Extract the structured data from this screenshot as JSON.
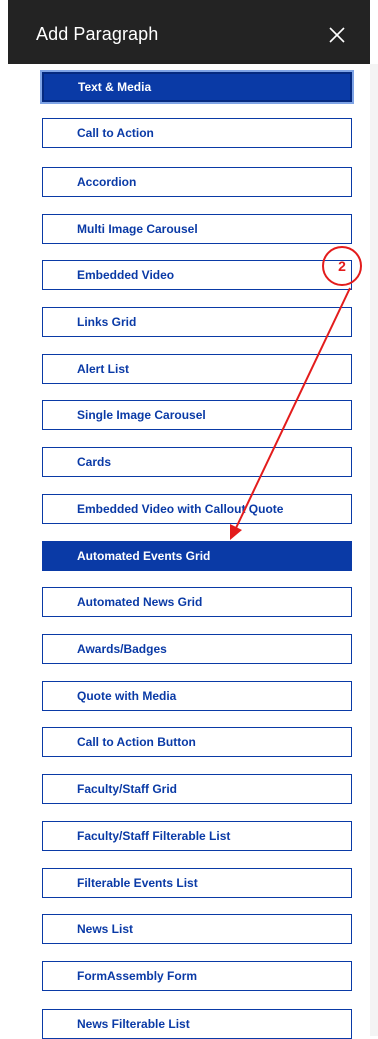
{
  "dialog": {
    "title": "Add Paragraph",
    "close_icon": "close-icon"
  },
  "paragraph_types": [
    {
      "label": "Text & Media",
      "state": "selected"
    },
    {
      "label": "Call to Action",
      "state": "normal"
    },
    {
      "label": "Accordion",
      "state": "normal"
    },
    {
      "label": "Multi Image Carousel",
      "state": "normal"
    },
    {
      "label": "Embedded Video",
      "state": "normal"
    },
    {
      "label": "Links Grid",
      "state": "normal"
    },
    {
      "label": "Alert List",
      "state": "normal"
    },
    {
      "label": "Single Image Carousel",
      "state": "normal"
    },
    {
      "label": "Cards",
      "state": "normal"
    },
    {
      "label": "Embedded Video with Callout Quote",
      "state": "normal"
    },
    {
      "label": "Automated Events Grid",
      "state": "highlighted"
    },
    {
      "label": "Automated News Grid",
      "state": "normal"
    },
    {
      "label": "Awards/Badges",
      "state": "normal"
    },
    {
      "label": "Quote with Media",
      "state": "normal"
    },
    {
      "label": "Call to Action Button",
      "state": "normal"
    },
    {
      "label": "Faculty/Staff Grid",
      "state": "normal"
    },
    {
      "label": "Faculty/Staff Filterable List",
      "state": "normal"
    },
    {
      "label": "Filterable Events List",
      "state": "normal"
    },
    {
      "label": "News List",
      "state": "normal"
    },
    {
      "label": "FormAssembly Form",
      "state": "normal"
    },
    {
      "label": "News Filterable List",
      "state": "normal"
    }
  ],
  "annotation": {
    "marker_label": "2",
    "color": "#e31c1c"
  },
  "colors": {
    "accent": "#0a3aa6",
    "titlebar": "#232323"
  }
}
